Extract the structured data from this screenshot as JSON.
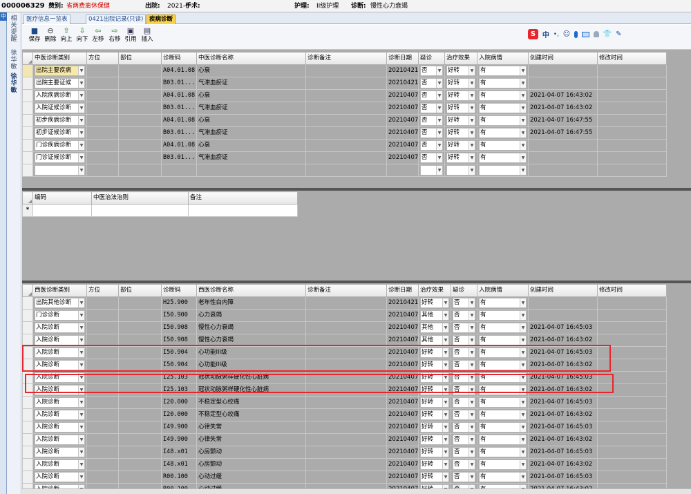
{
  "topbar": {
    "patient_no": "000006329",
    "category_label": "费别:",
    "category_value": "省两费离休保健",
    "discharge_label": "出院:",
    "discharge_value": "2021-(",
    "surgery_label": "手术:",
    "nursing_label": "护理:",
    "nursing_value": "II级护理",
    "diag_label": "诊断:",
    "diag_value": "慢性心力衰竭"
  },
  "sidebar": {
    "items": [
      "相关提醒",
      "徐华敏",
      "徐华敏"
    ]
  },
  "tabs": [
    {
      "label": "医疗信息一览表"
    },
    {
      "label": "0421出院记录(只读)"
    },
    {
      "label": "疾病诊断"
    }
  ],
  "toolbar": {
    "buttons": [
      {
        "label": "保存",
        "icon": "save-icon"
      },
      {
        "label": "删除",
        "icon": "delete-icon"
      },
      {
        "label": "向上",
        "icon": "arrow-up-icon"
      },
      {
        "label": "向下",
        "icon": "arrow-down-icon"
      },
      {
        "label": "左移",
        "icon": "arrow-left-icon"
      },
      {
        "label": "右移",
        "icon": "arrow-right-icon"
      },
      {
        "label": "引用",
        "icon": "quote-icon"
      },
      {
        "label": "插入",
        "icon": "insert-icon"
      }
    ],
    "ime_label": "中"
  },
  "tcm_table": {
    "headers": [
      "中医诊断类别",
      "方位",
      "部位",
      "诊断码",
      "中医诊断名称",
      "诊断备注",
      "诊断日期",
      "疑诊",
      "治疗效果",
      "入院病情",
      "创建时间",
      "修改时间"
    ],
    "rows": [
      {
        "type": "出院主要疾病",
        "code": "A04.01.08",
        "name": "心衰",
        "date": "20210421",
        "suspect": "否",
        "effect": "好转",
        "admit": "有",
        "created": "",
        "modified": ""
      },
      {
        "type": "出院主要证候",
        "code": "B03.01...",
        "name": "气滞血瘀证",
        "date": "20210421",
        "suspect": "否",
        "effect": "好转",
        "admit": "有",
        "created": "",
        "modified": ""
      },
      {
        "type": "入院疾病诊断",
        "code": "A04.01.08",
        "name": "心衰",
        "date": "20210407",
        "suspect": "否",
        "effect": "好转",
        "admit": "有",
        "created": "2021-04-07 16:43:02",
        "modified": ""
      },
      {
        "type": "入院证候诊断",
        "code": "B03.01...",
        "name": "气滞血瘀证",
        "date": "20210407",
        "suspect": "否",
        "effect": "好转",
        "admit": "有",
        "created": "2021-04-07 16:43:02",
        "modified": ""
      },
      {
        "type": "初步疾病诊断",
        "code": "A04.01.08",
        "name": "心衰",
        "date": "20210407",
        "suspect": "否",
        "effect": "好转",
        "admit": "有",
        "created": "2021-04-07 16:47:55",
        "modified": ""
      },
      {
        "type": "初步证候诊断",
        "code": "B03.01...",
        "name": "气滞血瘀证",
        "date": "20210407",
        "suspect": "否",
        "effect": "好转",
        "admit": "有",
        "created": "2021-04-07 16:47:55",
        "modified": ""
      },
      {
        "type": "门诊疾病诊断",
        "code": "A04.01.08",
        "name": "心衰",
        "date": "20210407",
        "suspect": "否",
        "effect": "好转",
        "admit": "有",
        "created": "",
        "modified": ""
      },
      {
        "type": "门诊证候诊断",
        "code": "B03.01...",
        "name": "气滞血瘀证",
        "date": "20210407",
        "suspect": "否",
        "effect": "好转",
        "admit": "有",
        "created": "",
        "modified": ""
      }
    ]
  },
  "method_table": {
    "headers": [
      "编码",
      "中医治法治则",
      "备注"
    ],
    "new_row_marker": "*"
  },
  "wm_table": {
    "headers": [
      "西医诊断类别",
      "方位",
      "部位",
      "诊断码",
      "西医诊断名称",
      "诊断备注",
      "诊断日期",
      "治疗效果",
      "疑诊",
      "入院病情",
      "创建时间",
      "修改时间"
    ],
    "rows": [
      {
        "type": "出院其他诊断",
        "code": "H25.900",
        "name": "老年性白内障",
        "date": "20210421",
        "effect": "好转",
        "suspect": "否",
        "admit": "有",
        "created": ""
      },
      {
        "type": "门诊诊断",
        "code": "I50.900",
        "name": "心力衰竭",
        "date": "20210407",
        "effect": "其他",
        "suspect": "否",
        "admit": "有",
        "created": ""
      },
      {
        "type": "入院诊断",
        "code": "I50.908",
        "name": "慢性心力衰竭",
        "date": "20210407",
        "effect": "其他",
        "suspect": "否",
        "admit": "有",
        "created": "2021-04-07 16:45:03"
      },
      {
        "type": "入院诊断",
        "code": "I50.908",
        "name": "慢性心力衰竭",
        "date": "20210407",
        "effect": "其他",
        "suspect": "否",
        "admit": "有",
        "created": "2021-04-07 16:43:02"
      },
      {
        "type": "入院诊断",
        "code": "I50.904",
        "name": "心功能III级",
        "date": "20210407",
        "effect": "好转",
        "suspect": "否",
        "admit": "有",
        "created": "2021-04-07 16:45:03"
      },
      {
        "type": "入院诊断",
        "code": "I50.904",
        "name": "心功能III级",
        "date": "20210407",
        "effect": "好转",
        "suspect": "否",
        "admit": "有",
        "created": "2021-04-07 16:43:02"
      },
      {
        "type": "入院诊断",
        "code": "I25.103",
        "name": "冠状动脉粥样硬化性心脏病",
        "date": "20210407",
        "effect": "好转",
        "suspect": "否",
        "admit": "有",
        "created": "2021-04-07 16:45:03"
      },
      {
        "type": "入院诊断",
        "code": "I25.103",
        "name": "冠状动脉粥样硬化性心脏病",
        "date": "20210407",
        "effect": "好转",
        "suspect": "否",
        "admit": "有",
        "created": "2021-04-07 16:43:02"
      },
      {
        "type": "入院诊断",
        "code": "I20.000",
        "name": "不稳定型心绞痛",
        "date": "20210407",
        "effect": "好转",
        "suspect": "否",
        "admit": "有",
        "created": "2021-04-07 16:45:03"
      },
      {
        "type": "入院诊断",
        "code": "I20.000",
        "name": "不稳定型心绞痛",
        "date": "20210407",
        "effect": "好转",
        "suspect": "否",
        "admit": "有",
        "created": "2021-04-07 16:43:02"
      },
      {
        "type": "入院诊断",
        "code": "I49.900",
        "name": "心律失常",
        "date": "20210407",
        "effect": "好转",
        "suspect": "否",
        "admit": "有",
        "created": "2021-04-07 16:45:03"
      },
      {
        "type": "入院诊断",
        "code": "I49.900",
        "name": "心律失常",
        "date": "20210407",
        "effect": "好转",
        "suspect": "否",
        "admit": "有",
        "created": "2021-04-07 16:43:02"
      },
      {
        "type": "入院诊断",
        "code": "I48.x01",
        "name": "心房颤动",
        "date": "20210407",
        "effect": "好转",
        "suspect": "否",
        "admit": "有",
        "created": "2021-04-07 16:45:03"
      },
      {
        "type": "入院诊断",
        "code": "I48.x01",
        "name": "心房颤动",
        "date": "20210407",
        "effect": "好转",
        "suspect": "否",
        "admit": "有",
        "created": "2021-04-07 16:43:02"
      },
      {
        "type": "入院诊断",
        "code": "R00.100",
        "name": "心动过缓",
        "date": "20210407",
        "effect": "好转",
        "suspect": "否",
        "admit": "有",
        "created": "2021-04-07 16:45:03"
      },
      {
        "type": "入院诊断",
        "code": "R00.100",
        "name": "心动过缓",
        "date": "20210407",
        "effect": "好转",
        "suspect": "否",
        "admit": "有",
        "created": "2021-04-07 16:43:02"
      }
    ]
  },
  "colors": {
    "highlight": "#e8262b",
    "active_tab": "#f7d24a",
    "red_text": "#d40000"
  }
}
